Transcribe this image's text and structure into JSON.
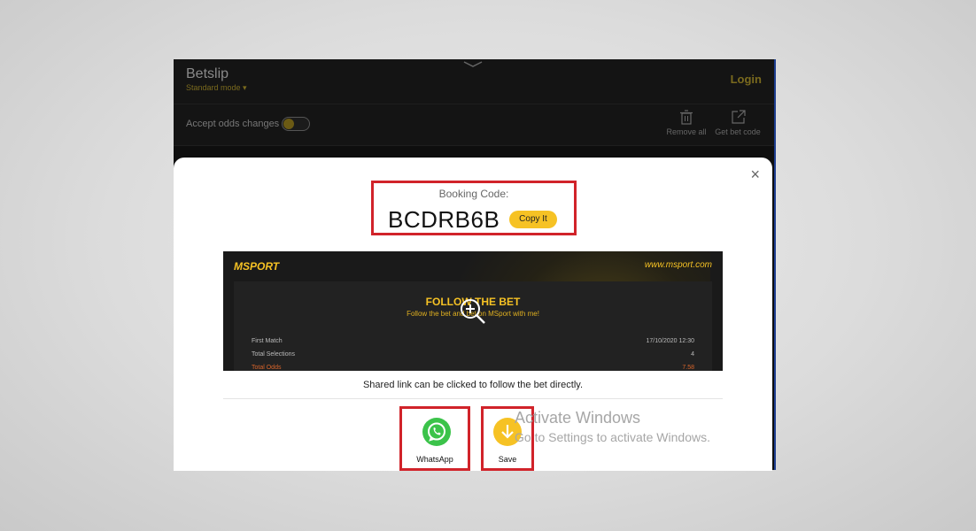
{
  "betslip": {
    "title": "Betslip",
    "mode": "Standard mode ▾",
    "login": "Login",
    "accept_odds": "Accept odds changes",
    "remove_all": "Remove all",
    "get_bet_code": "Get bet code"
  },
  "modal": {
    "close": "×",
    "booking_label": "Booking Code:",
    "booking_code": "BCDRB6B",
    "copy_label": "Copy It",
    "preview": {
      "brand": "MSPORT",
      "site": "www.msport.com",
      "follow_title": "FOLLOW THE BET",
      "follow_sub": "Follow the bet and bet on MSport with me!",
      "rows": [
        {
          "label": "First Match",
          "value": "17/10/2020 12:30"
        },
        {
          "label": "Total Selections",
          "value": "4"
        },
        {
          "label": "Total Odds",
          "value": "7.58"
        }
      ]
    },
    "shared_note": "Shared link can be clicked to follow the bet directly.",
    "share": {
      "whatsapp": "WhatsApp",
      "save": "Save"
    }
  },
  "watermark": {
    "line1": "Activate Windows",
    "line2": "Go to Settings to activate Windows."
  },
  "colors": {
    "accent": "#f6c224",
    "highlight": "#d1232a",
    "whatsapp": "#3bc34a"
  }
}
